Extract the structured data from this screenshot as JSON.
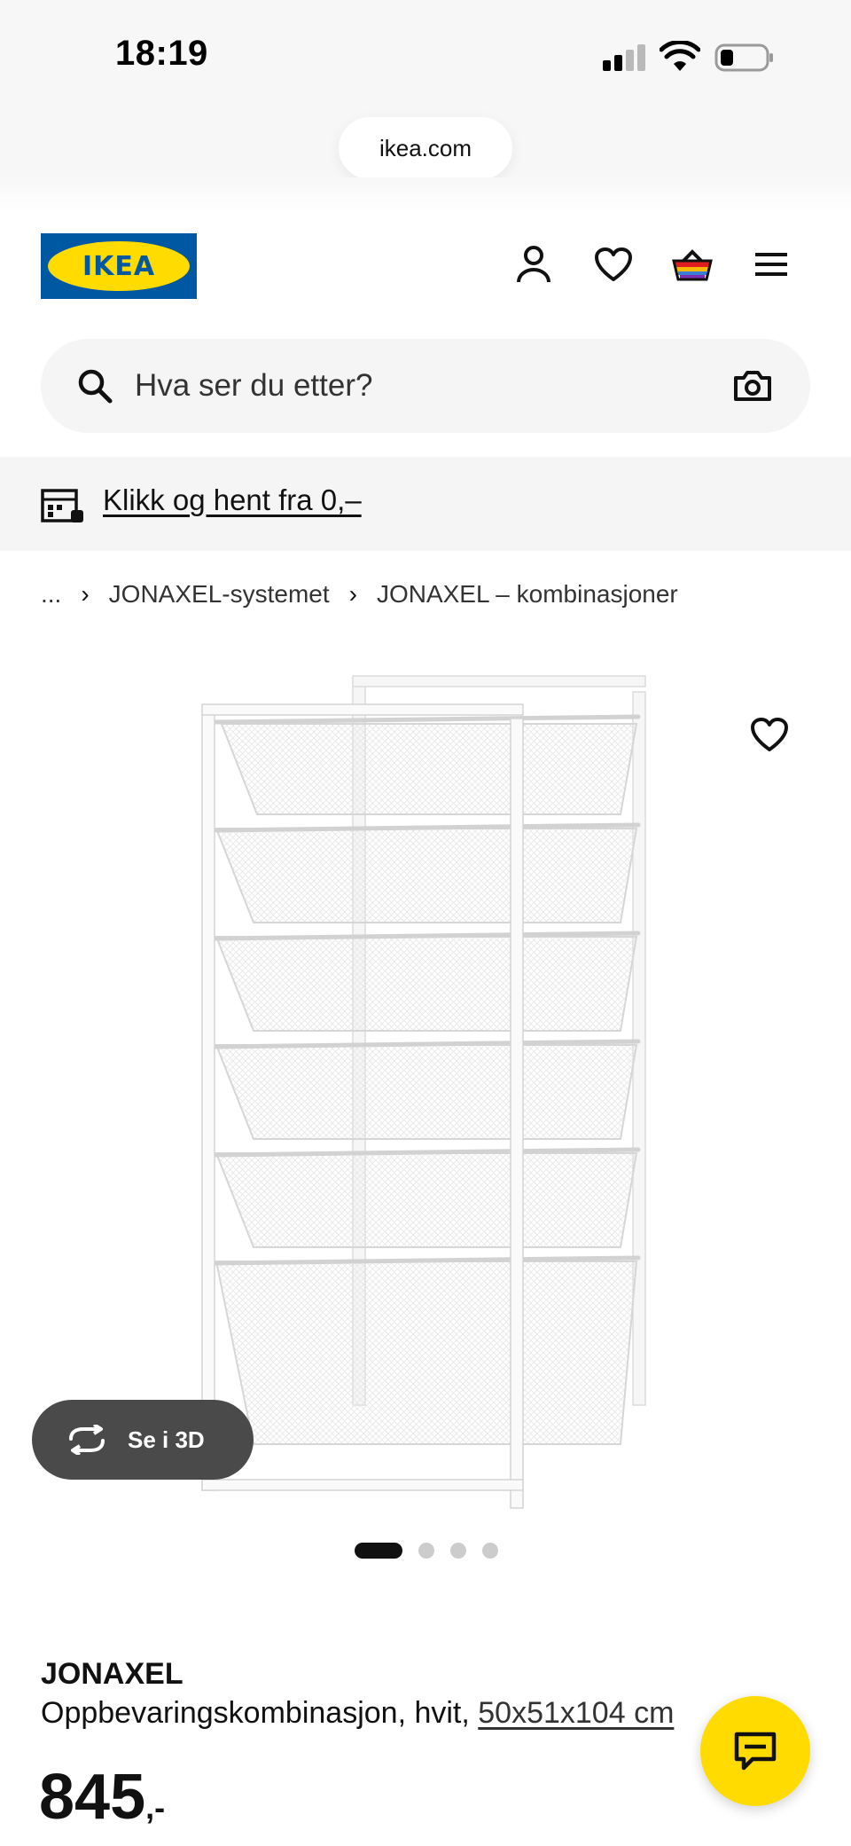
{
  "status_bar": {
    "time": "18:19"
  },
  "browser": {
    "url": "ikea.com"
  },
  "header": {
    "logo_text": "IKEA",
    "brand_blue": "#0058a3",
    "brand_yellow": "#ffdb00",
    "icons": [
      "account-icon",
      "heart-icon",
      "cart-icon",
      "menu-icon"
    ]
  },
  "search": {
    "placeholder": "Hva ser du etter?"
  },
  "banner": {
    "link_text": "Klikk og hent fra 0,–"
  },
  "breadcrumb": {
    "ellipsis": "...",
    "items": [
      "JONAXEL-systemet",
      "JONAXEL – kombinasjoner"
    ]
  },
  "gallery": {
    "view_3d_label": "Se i 3D",
    "total_images": 4,
    "active_index": 0
  },
  "product": {
    "name": "JONAXEL",
    "description": "Oppbevaringskombinasjon, hvit, ",
    "dimensions": "50x51x104 cm",
    "price": "845",
    "price_suffix": ",-"
  }
}
